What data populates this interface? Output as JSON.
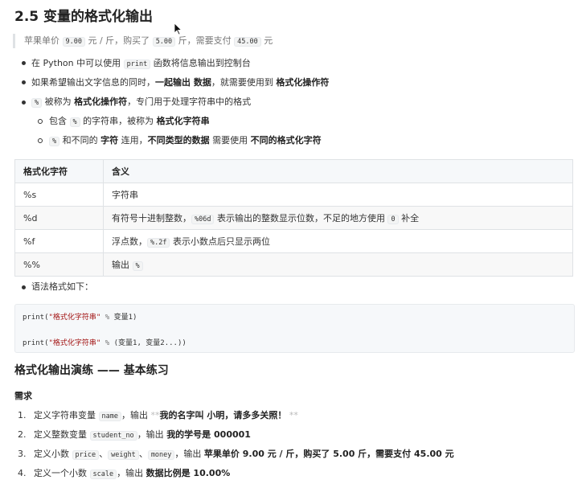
{
  "heading": "2.5 变量的格式化输出",
  "quote": {
    "p1": "苹果单价",
    "v1": "9.00",
    "p2": "元 / 斤，购买了",
    "v2": "5.00",
    "p3": "斤，需要支付",
    "v3": "45.00",
    "p4": "元"
  },
  "bullets": [
    {
      "a": "在 Python 中可以使用",
      "code": "print",
      "b": "函数将信息输出到控制台"
    },
    {
      "a": "如果希望输出文字信息的同时，",
      "bold1": "一起输出 数据",
      "b": "，就需要使用到",
      "bold2": "格式化操作符"
    },
    {
      "code": "%",
      "a": "被称为",
      "bold1": "格式化操作符",
      "b": "，专门用于处理字符串中的格式"
    }
  ],
  "sub_bullets": [
    {
      "a": "包含",
      "code": "%",
      "b": "的字符串，被称为",
      "bold1": "格式化字符串"
    },
    {
      "code": "%",
      "a": "和不同的",
      "bold1": "字符",
      "b": "连用，",
      "bold2": "不同类型的数据",
      "c": "需要使用",
      "bold3": "不同的格式化字符"
    }
  ],
  "table": {
    "headers": [
      "格式化字符",
      "含义"
    ],
    "rows": [
      {
        "k": "%s",
        "a": "字符串"
      },
      {
        "k": "%d",
        "a": "有符号十进制整数，",
        "code": "%06d",
        "b": "表示输出的整数显示位数，不足的地方使用",
        "code2": "0",
        "c": "补全"
      },
      {
        "k": "%f",
        "a": "浮点数，",
        "code": "%.2f",
        "b": "表示小数点后只显示两位"
      },
      {
        "k": "%%",
        "a": "输出",
        "code": "%"
      }
    ]
  },
  "syntax_bullet": "语法格式如下：",
  "code": {
    "line1": {
      "fn": "print(",
      "str": "\"格式化字符串\"",
      "op": " % ",
      "rest": "变量1)"
    },
    "line2": {
      "fn": "print(",
      "str": "\"格式化字符串\"",
      "op": " % ",
      "rest": "(变量1, 变量2...))"
    }
  },
  "section_title": "格式化输出演练 —— 基本练习",
  "requirement_label": "需求",
  "requirements": [
    {
      "n": "1.",
      "a": "定义字符串变量",
      "code": "name",
      "b": "，输出",
      "stars1": "**",
      "bold": "我的名字叫 小明，请多多关照！",
      "stars2": "**"
    },
    {
      "n": "2.",
      "a": "定义整数变量",
      "code": "student_no",
      "b": "，输出",
      "bold": "我的学号是 000001"
    },
    {
      "n": "3.",
      "a": "定义小数",
      "code": "price",
      "sep1": "、",
      "code2": "weight",
      "sep2": "、",
      "code3": "money",
      "b": "，输出",
      "bold": "苹果单价 9.00 元 / 斤，购买了 5.00 斤，需要支付 45.00 元"
    },
    {
      "n": "4.",
      "a": "定义一个小数",
      "code": "scale",
      "b": "，输出",
      "bold": "数据比例是 10.00%"
    }
  ]
}
